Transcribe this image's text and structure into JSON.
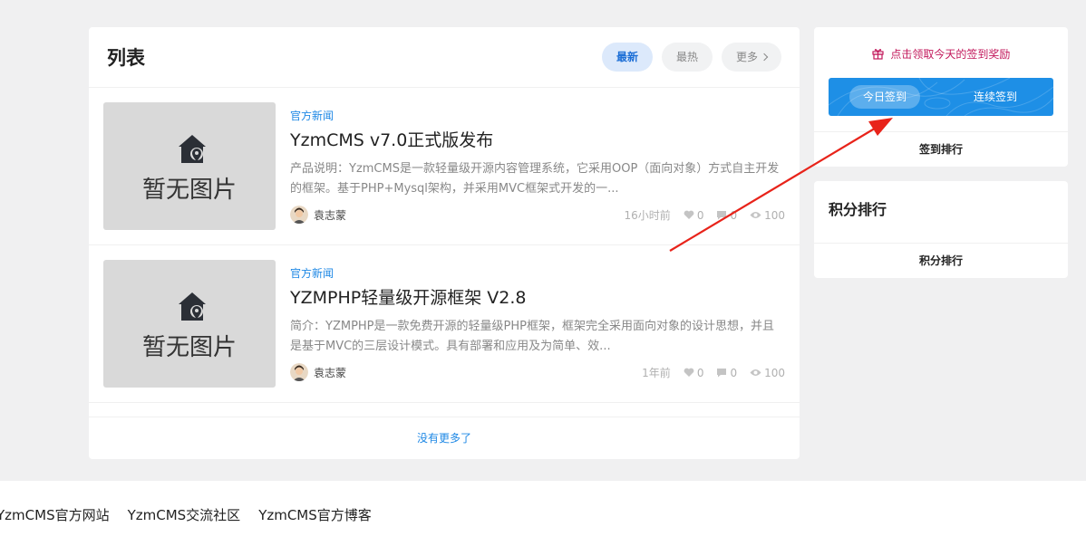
{
  "list": {
    "title": "列表",
    "tabs": [
      {
        "label": "最新",
        "active": true
      },
      {
        "label": "最热",
        "active": false
      },
      {
        "label": "更多",
        "active": false
      }
    ],
    "placeholder_image_text": "暂无图片",
    "posts": [
      {
        "category": "官方新闻",
        "title": "YzmCMS v7.0正式版发布",
        "excerpt": "产品说明：YzmCMS是一款轻量级开源内容管理系统，它采用OOP（面向对象）方式自主开发的框架。基于PHP+Mysql架构，并采用MVC框架式开发的一...",
        "author": "袁志蒙",
        "time": "16小时前",
        "likes": "0",
        "comments": "0",
        "views": "100"
      },
      {
        "category": "官方新闻",
        "title": "YZMPHP轻量级开源框架 V2.8",
        "excerpt": "简介：YZMPHP是一款免费开源的轻量级PHP框架，框架完全采用面向对象的设计思想，并且是基于MVC的三层设计模式。具有部署和应用及为简单、效...",
        "author": "袁志蒙",
        "time": "1年前",
        "likes": "0",
        "comments": "0",
        "views": "100"
      }
    ],
    "no_more": "没有更多了"
  },
  "signin": {
    "reward_text": "点击领取今天的签到奖励",
    "today_button": "今日签到",
    "streak_label": "连续签到",
    "ranking_link": "签到排行",
    "colors": {
      "bar": "#1e8fe6",
      "reward": "#c2185b"
    }
  },
  "points": {
    "title": "积分排行",
    "ranking_link": "积分排行"
  },
  "footer": {
    "links": [
      "YzmCMS官方网站",
      "YzmCMS交流社区",
      "YzmCMS官方博客"
    ]
  },
  "icons": {
    "annotation_arrow": "red-arrow",
    "thumb": "house-pin-icon",
    "gift": "gift-icon",
    "like": "heart-icon",
    "comment": "comment-icon",
    "view": "eye-icon"
  }
}
